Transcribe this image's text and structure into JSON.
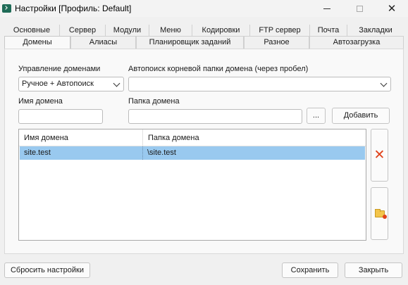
{
  "window": {
    "title": "Настройки [Профиль: Default]",
    "controls": {
      "minimize": "—",
      "maximize": "☐",
      "close": "✕"
    }
  },
  "tabs_row1": [
    "Основные",
    "Сервер",
    "Модули",
    "Меню",
    "Кодировки",
    "FTP сервер",
    "Почта",
    "Закладки"
  ],
  "tabs_row2": [
    "Домены",
    "Алиасы",
    "Планировщик заданий",
    "Разное",
    "Автозагрузка"
  ],
  "active_tab": "Домены",
  "domains_panel": {
    "management_label": "Управление доменами",
    "management_value": "Ручное + Автопоиск",
    "autosearch_label": "Автопоиск корневой папки домена (через пробел)",
    "autosearch_value": "",
    "domain_name_label": "Имя домена",
    "domain_name_value": "",
    "domain_folder_label": "Папка домена",
    "domain_folder_value": "",
    "browse_label": "...",
    "add_label": "Добавить",
    "table": {
      "columns": [
        "Имя домена",
        "Папка домена"
      ],
      "rows": [
        {
          "name": "site.test",
          "folder": "\\site.test",
          "selected": true
        }
      ]
    }
  },
  "footer": {
    "reset_label": "Сбросить настройки",
    "save_label": "Сохранить",
    "close_label": "Закрыть"
  },
  "colors": {
    "selection": "#99c9ef",
    "delete_icon": "#e0421b",
    "folder_icon": "#f3c54b"
  }
}
